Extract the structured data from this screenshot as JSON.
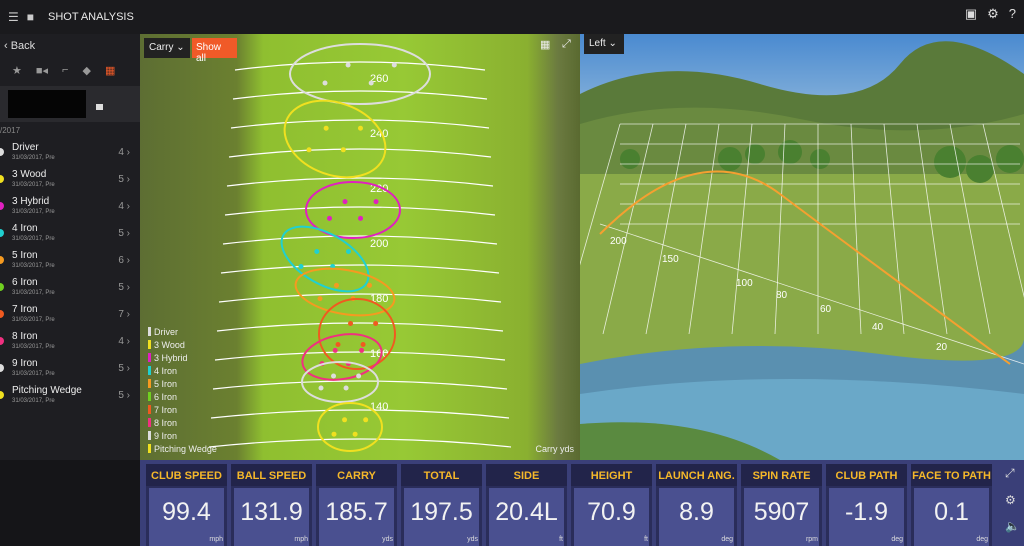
{
  "app": {
    "title": "SHOT ANALYSIS",
    "icons": [
      "menu-icon",
      "folder-icon"
    ],
    "top_right_icons": [
      "monitor-icon",
      "gear-icon",
      "help-icon"
    ]
  },
  "sidebar": {
    "back": "‹ Back",
    "date_header": "/2017",
    "clubs": [
      {
        "name": "Driver",
        "date": "31/03/2017, Pre",
        "count": "4 ›",
        "color": "#dddddd"
      },
      {
        "name": "3 Wood",
        "date": "31/03/2017, Pre",
        "count": "5 ›",
        "color": "#f0e020"
      },
      {
        "name": "3 Hybrid",
        "date": "31/03/2017, Pre",
        "count": "4 ›",
        "color": "#e020c0"
      },
      {
        "name": "4 Iron",
        "date": "31/03/2017, Pre",
        "count": "5 ›",
        "color": "#20d0d0"
      },
      {
        "name": "5 Iron",
        "date": "31/03/2017, Pre",
        "count": "6 ›",
        "color": "#f59a20"
      },
      {
        "name": "6 Iron",
        "date": "31/03/2017, Pre",
        "count": "5 ›",
        "color": "#70d020"
      },
      {
        "name": "7 Iron",
        "date": "31/03/2017, Pre",
        "count": "7 ›",
        "color": "#f05a20"
      },
      {
        "name": "8 Iron",
        "date": "31/03/2017, Pre",
        "count": "4 ›",
        "color": "#f03080"
      },
      {
        "name": "9 Iron",
        "date": "31/03/2017, Pre",
        "count": "5 ›",
        "color": "#dddddd"
      },
      {
        "name": "Pitching Wedge",
        "date": "31/03/2017, Pre",
        "count": "5 ›",
        "color": "#f0e020"
      }
    ]
  },
  "fairway": {
    "metric": "Carry",
    "show_all": "Show all",
    "yard_labels": [
      "260",
      "240",
      "220",
      "200",
      "180",
      "160",
      "140"
    ],
    "axis_label": "Carry yds"
  },
  "view3d": {
    "camera": "Left",
    "distance_labels": [
      "200",
      "150",
      "100",
      "80",
      "60",
      "40",
      "20"
    ]
  },
  "stats": [
    {
      "label": "CLUB SPEED",
      "value": "99.4",
      "unit": "mph"
    },
    {
      "label": "BALL SPEED",
      "value": "131.9",
      "unit": "mph"
    },
    {
      "label": "CARRY",
      "value": "185.7",
      "unit": "yds"
    },
    {
      "label": "TOTAL",
      "value": "197.5",
      "unit": "yds"
    },
    {
      "label": "SIDE",
      "value": "20.4L",
      "unit": "ft"
    },
    {
      "label": "HEIGHT",
      "value": "70.9",
      "unit": "ft"
    },
    {
      "label": "LAUNCH ANG.",
      "value": "8.9",
      "unit": "deg"
    },
    {
      "label": "SPIN RATE",
      "value": "5907",
      "unit": "rpm"
    },
    {
      "label": "CLUB PATH",
      "value": "-1.9",
      "unit": "deg"
    },
    {
      "label": "FACE TO PATH",
      "value": "0.1",
      "unit": "deg"
    }
  ],
  "colors": {
    "accent": "#f05a28",
    "stat_label": "#f5b82a",
    "trajectory": "#f5a030"
  }
}
